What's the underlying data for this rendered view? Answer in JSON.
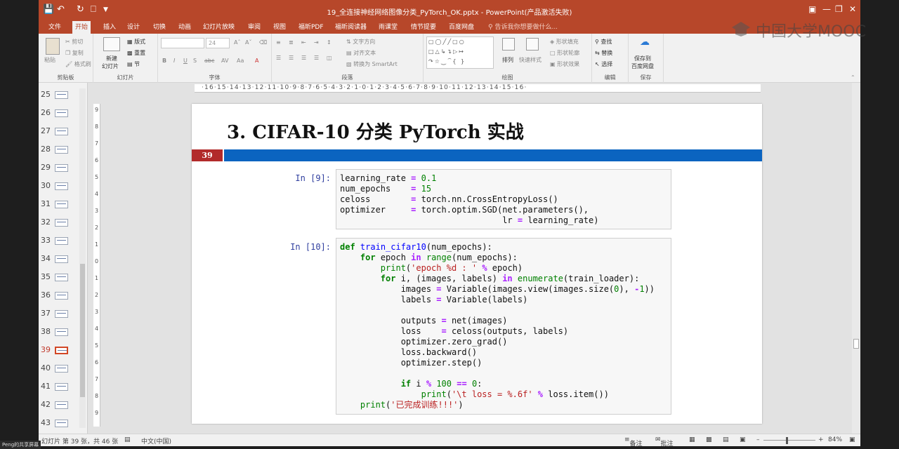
{
  "window": {
    "title": "19_全连接神经网络图像分类_PyTorch_OK.pptx - PowerPoint(产品激活失败)"
  },
  "tabs": [
    {
      "label": "文件"
    },
    {
      "label": "开始"
    },
    {
      "label": "插入"
    },
    {
      "label": "设计"
    },
    {
      "label": "切换"
    },
    {
      "label": "动画"
    },
    {
      "label": "幻灯片放映"
    },
    {
      "label": "审阅"
    },
    {
      "label": "视图"
    },
    {
      "label": "福昕PDF"
    },
    {
      "label": "福昕阅读器"
    },
    {
      "label": "雨课堂"
    },
    {
      "label": "情节提要"
    },
    {
      "label": "百度网盘"
    }
  ],
  "tell_me": "告诉我你想要做什么...",
  "ribbon": {
    "groups": {
      "clipboard": "剪贴板",
      "slides": "幻灯片",
      "font": "字体",
      "paragraph": "段落",
      "drawing": "绘图",
      "editing": "编辑",
      "save": "保存"
    },
    "clipboard": {
      "paste": "粘贴",
      "cut": "剪切",
      "copy": "复制",
      "format_painter": "格式刷"
    },
    "slides": {
      "new_slide_1": "新建",
      "new_slide_2": "幻灯片",
      "layout": "版式",
      "reset": "重置",
      "section": "节"
    },
    "font": {
      "size": "24"
    },
    "paragraph": {
      "text_direction": "文字方向",
      "align_text": "对齐文本",
      "smartart": "转换为 SmartArt"
    },
    "drawing": {
      "arrange": "排列",
      "quick_styles": "快速样式",
      "fill": "形状填充",
      "outline": "形状轮廓",
      "effects": "形状效果"
    },
    "editing": {
      "find": "查找",
      "replace": "替换",
      "select": "选择"
    },
    "save": {
      "line1": "保存到",
      "line2": "百度网盘"
    }
  },
  "thumbnails": [
    {
      "num": "25"
    },
    {
      "num": "26"
    },
    {
      "num": "27"
    },
    {
      "num": "28"
    },
    {
      "num": "29"
    },
    {
      "num": "30"
    },
    {
      "num": "31"
    },
    {
      "num": "32"
    },
    {
      "num": "33"
    },
    {
      "num": "34"
    },
    {
      "num": "35"
    },
    {
      "num": "36"
    },
    {
      "num": "37"
    },
    {
      "num": "38"
    },
    {
      "num": "39"
    },
    {
      "num": "40"
    },
    {
      "num": "41"
    },
    {
      "num": "42"
    },
    {
      "num": "43"
    }
  ],
  "active_thumbnail": "39",
  "ruler": {
    "horizontal": "·16·15·14·13·12·11·10·9·8·7·6·5·4·3·2·1·0·1·2·3·4·5·6·7·8·9·10·11·12·13·14·15·16·",
    "vertical": [
      "9",
      "8",
      "7",
      "6",
      "5",
      "4",
      "3",
      "2",
      "1",
      "0",
      "1",
      "2",
      "3",
      "4",
      "5",
      "6",
      "7",
      "8",
      "9"
    ]
  },
  "slide": {
    "title": "3.  CIFAR-10 分类 PyTorch 实战",
    "number": "39",
    "cells": [
      {
        "prompt": "In [9]:",
        "lines": [
          "learning_rate = 0.1",
          "num_epochs    = 15",
          "celoss        = torch.nn.CrossEntropyLoss()",
          "optimizer     = torch.optim.SGD(net.parameters(),",
          "                                lr = learning_rate)"
        ]
      },
      {
        "prompt": "In [10]:",
        "lines": [
          "def train_cifar10(num_epochs):",
          "    for epoch in range(num_epochs):",
          "        print('epoch %d : ' % epoch)",
          "        for i, (images, labels) in enumerate(train_loader):",
          "            images = Variable(images.view(images.size(0), -1))",
          "            labels = Variable(labels)",
          "",
          "            outputs = net(images)",
          "            loss    = celoss(outputs, labels)",
          "            optimizer.zero_grad()",
          "            loss.backward()",
          "            optimizer.step()",
          "",
          "            if i % 100 == 0:",
          "                print('\\t loss = %.6f' % loss.item())",
          "    print('已完成训练!!!')"
        ]
      }
    ]
  },
  "status": {
    "slide_info": "幻灯片 第 39 张，共 46 张",
    "language": "中文(中国)",
    "notes": "备注",
    "comments": "批注",
    "zoom": "84%"
  },
  "watermark": "中国大学MOOC",
  "share_badge": "Peng的共享屏幕"
}
